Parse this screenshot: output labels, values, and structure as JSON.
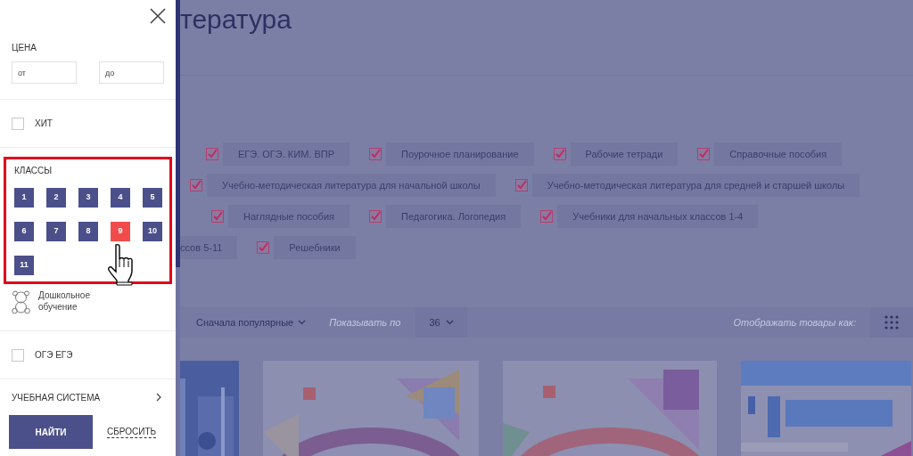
{
  "sidebar": {
    "price": {
      "label": "ЦЕНА",
      "from": {
        "placeholder": "от"
      },
      "to": {
        "placeholder": "до"
      }
    },
    "hit": {
      "label": "ХИТ",
      "checked": false
    },
    "grades": {
      "label": "КЛАССЫ",
      "highlighted": true,
      "items": [
        {
          "label": "1",
          "selected": false
        },
        {
          "label": "2",
          "selected": false
        },
        {
          "label": "3",
          "selected": false
        },
        {
          "label": "4",
          "selected": false
        },
        {
          "label": "5",
          "selected": false
        },
        {
          "label": "6",
          "selected": false
        },
        {
          "label": "7",
          "selected": false
        },
        {
          "label": "8",
          "selected": false
        },
        {
          "label": "9",
          "selected": true
        },
        {
          "label": "10",
          "selected": false
        },
        {
          "label": "11",
          "selected": false
        }
      ]
    },
    "preschool": {
      "label": "Дошкольное обучение"
    },
    "exam": {
      "label": "ОГЭ ЕГЭ",
      "checked": false
    },
    "system": {
      "label": "УЧЕБНАЯ СИСТЕМА"
    },
    "search_button": "НАЙТИ",
    "reset_link": "СБРОСИТЬ"
  },
  "page": {
    "title": "тература",
    "tag_rows": [
      [
        {
          "label": "ЕГЭ. ОГЭ. КИМ. ВПР",
          "checked": true
        },
        {
          "label": "Поурочное планирование",
          "checked": true
        },
        {
          "label": "Рабочие тетради",
          "checked": true
        },
        {
          "label": "Справочные пособия",
          "checked": true
        }
      ],
      [
        {
          "label": "Учебно-методическая литература для начальной школы",
          "checked": true
        },
        {
          "label": "Учебно-методическая литература для средней и старшей школы",
          "checked": true
        }
      ],
      [
        {
          "label": "Наглядные пособия",
          "checked": true
        },
        {
          "label": "Педагогика. Логопедия",
          "checked": true
        },
        {
          "label": "Учебники для начальных классов 1-4",
          "checked": true
        }
      ],
      [
        {
          "label": "ссов 5-11"
        },
        {
          "label": "Решебники",
          "checked": true
        }
      ]
    ],
    "toolbar": {
      "sort": "Сначала популярные",
      "per_page_label": "Показывать по",
      "per_page": "36",
      "view_label": "Отображать товары как:"
    },
    "books": [
      {
        "kind": "picture"
      },
      {
        "kind": "picture"
      },
      {
        "kind": "picture"
      },
      {
        "kind": "picture"
      }
    ]
  }
}
